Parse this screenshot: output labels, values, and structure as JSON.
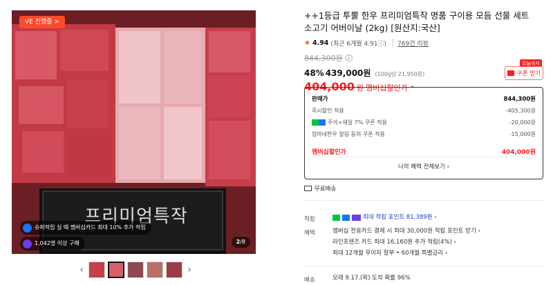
{
  "gallery": {
    "badge": "VE 진행중 >",
    "overlay1": "슈퍼적립 실 때 멤버십카드 최대 10% 추가 적립",
    "overlay2": "1,042명 이상 구매",
    "page_current": "2",
    "page_total": "/8",
    "thumb_count": 5,
    "prev_arrow": "‹",
    "next_arrow": "›",
    "box_text": "프리미엄특작"
  },
  "product": {
    "title": "++1등급 투뿔 한우 프리미엄특작 명품 구이용 모듬 선물 세트 소고기 어버이날 (2kg) [원산지:국산]",
    "rating_star": "★",
    "rating_score": "4.94",
    "rating_recent": "(최근 6개월 4.91ⓘ)",
    "review_count": "769건 리뷰",
    "original_price": "844,300원",
    "discount_pct": "48%",
    "sale_price": "439,000원",
    "unit_price": "(100g당 21,950원)",
    "member_price": "404,000",
    "member_price_won": "원",
    "member_label": "멤버십할인가",
    "member_caret": "^",
    "coupon_tag": "오늘까지",
    "coupon_label": "쿠폰 받기"
  },
  "price_box": {
    "rows": [
      {
        "label": "판매가",
        "value": "844,300원"
      },
      {
        "label": "즉시할인 적용",
        "value": "-405,300원"
      },
      {
        "label": "주석+세일 7% 쿠폰 적용",
        "value": "-20,000원"
      },
      {
        "label": "엄마네한우 알림 동의 쿠폰 적용",
        "value": "-15,000원"
      }
    ],
    "total_label": "멤버십할인가",
    "total_value": "404,000원",
    "benefit_button": "나의 혜택 전체보기 ›"
  },
  "shipping": {
    "label": "무료배송"
  },
  "points": {
    "label": "적립",
    "value": "최대 적립 포인트 81,389원 ›"
  },
  "benefits": {
    "label": "혜택",
    "lines": [
      "멤버십 전용카드 결제 시 최대 30,000원 적립 포인트 받기 ›",
      "라인프렌즈 카드 최대 16,160원 추가 적립(4%) ›",
      "최대 12개월 무이자 할부 • 60개월 특별금리 ›"
    ]
  },
  "delivery": {
    "label": "배송",
    "value": "모레 9.17.(목) 도착 확률 96%"
  },
  "colors": {
    "accent_red": "#ff1e1e",
    "badge_orange": "#ff4a2a",
    "point_blue": "#1a3fd6"
  }
}
